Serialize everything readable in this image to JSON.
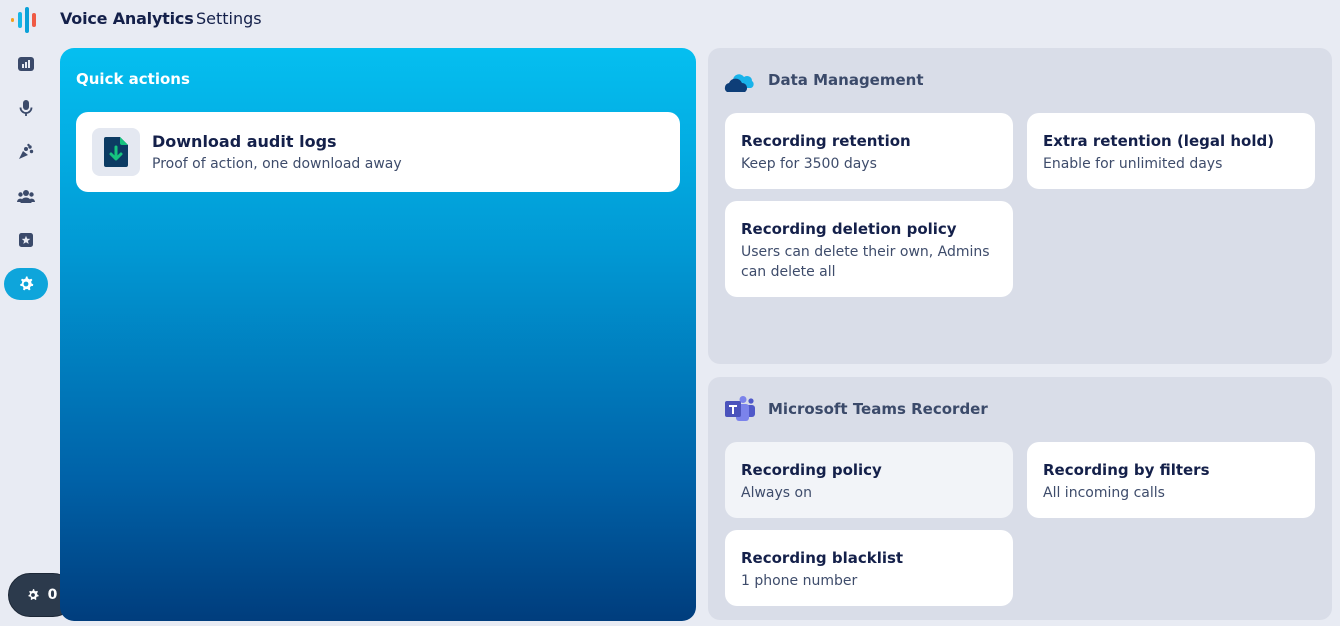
{
  "app": {
    "title": "Voice Analytics",
    "page": "Settings"
  },
  "sidebar": {
    "items": [
      {
        "name": "dashboard-icon",
        "active": false
      },
      {
        "name": "microphone-icon",
        "active": false
      },
      {
        "name": "paw-icon",
        "active": false
      },
      {
        "name": "team-icon",
        "active": false
      },
      {
        "name": "star-box-icon",
        "active": false
      },
      {
        "name": "gear-icon",
        "active": true
      }
    ]
  },
  "settings_pill": {
    "count": "0",
    "icon": "gear-icon"
  },
  "quick_actions": {
    "title": "Quick actions",
    "items": [
      {
        "title": "Download audit logs",
        "subtitle": "Proof of action, one download away",
        "icon": "download-file-icon"
      }
    ]
  },
  "data_management": {
    "title": "Data Management",
    "icon": "cloud-icon",
    "cards": [
      {
        "title": "Recording retention",
        "subtitle": "Keep for 3500 days"
      },
      {
        "title": "Extra retention (legal hold)",
        "subtitle": "Enable for unlimited days"
      },
      {
        "title": "Recording deletion policy",
        "subtitle": "Users can delete their own, Admins can delete all"
      }
    ]
  },
  "teams_recorder": {
    "title": "Microsoft Teams Recorder",
    "icon": "teams-icon",
    "cards": [
      {
        "title": "Recording policy",
        "subtitle": "Always on"
      },
      {
        "title": "Recording by filters",
        "subtitle": "All incoming calls"
      },
      {
        "title": "Recording blacklist",
        "subtitle": "1 phone number"
      }
    ]
  },
  "colors": {
    "accent": "#0ea5db",
    "background": "#e8ebf3",
    "section": "#d9dde8",
    "text": "#14204a"
  }
}
